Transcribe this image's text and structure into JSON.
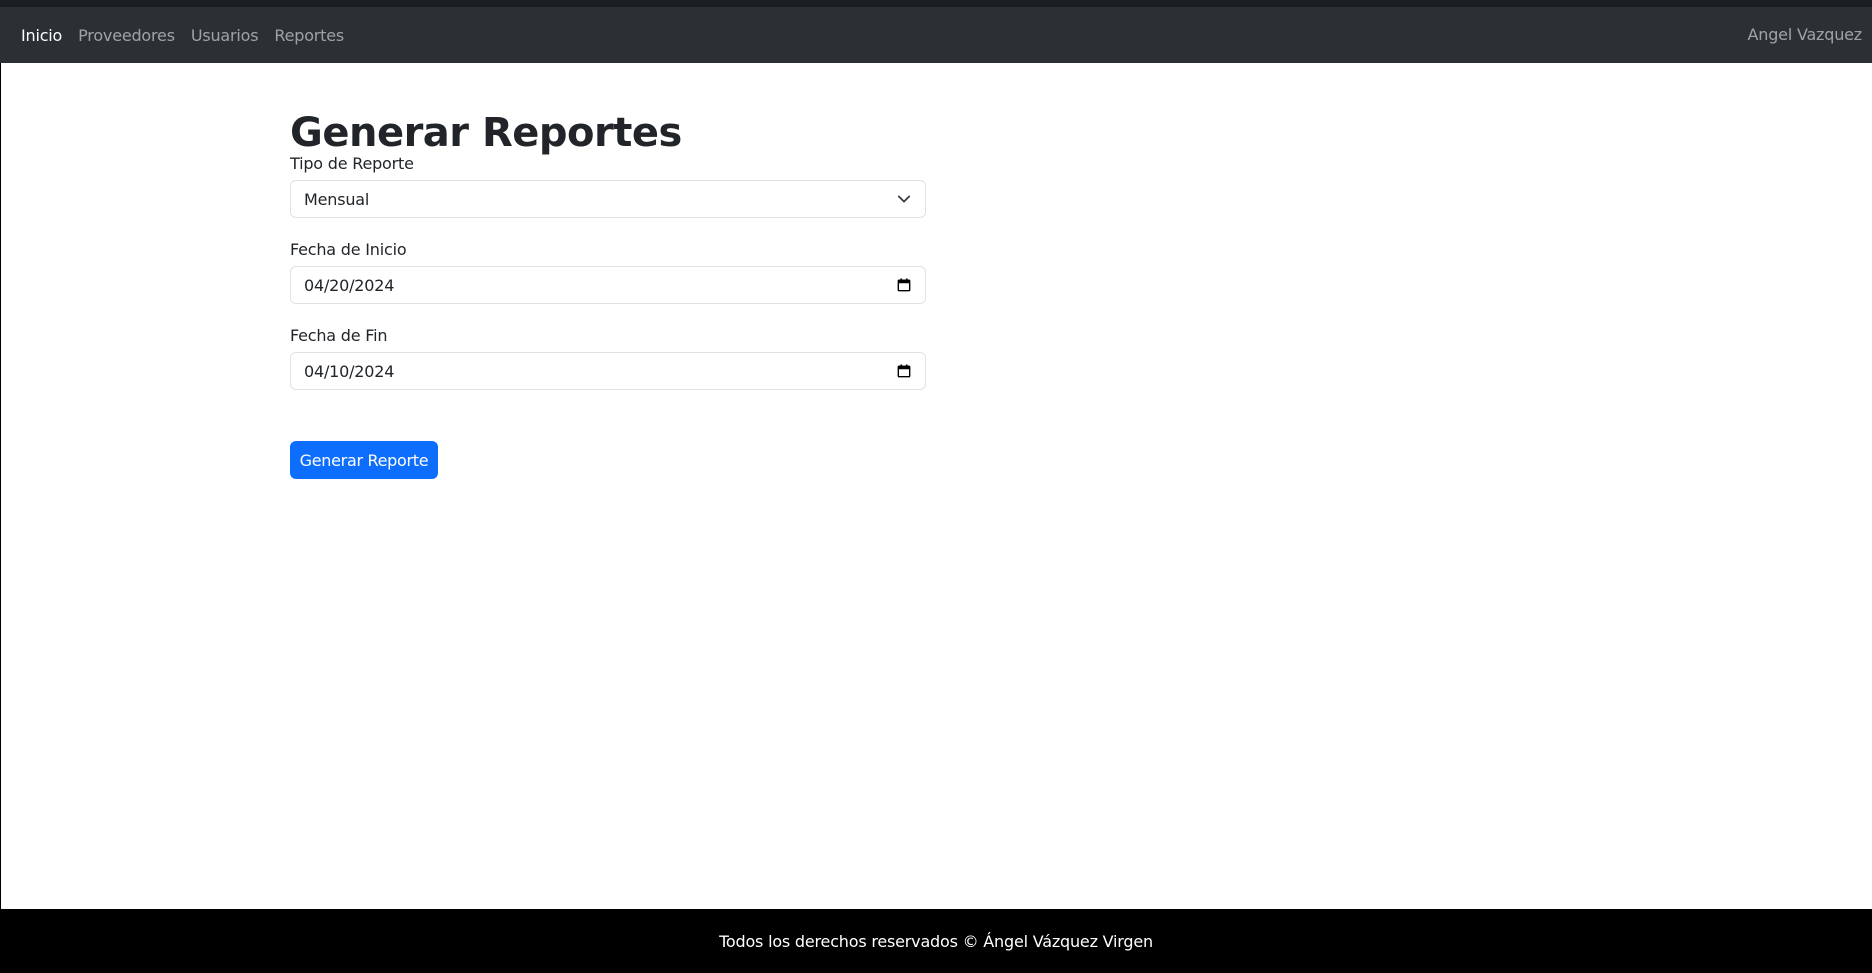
{
  "navbar": {
    "links": [
      {
        "label": "Inicio",
        "active": true
      },
      {
        "label": "Proveedores",
        "active": false
      },
      {
        "label": "Usuarios",
        "active": false
      },
      {
        "label": "Reportes",
        "active": false
      }
    ],
    "user_name": "Angel Vazquez"
  },
  "main": {
    "title": "Generar Reportes",
    "form": {
      "report_type": {
        "label": "Tipo de Reporte",
        "value": "Mensual",
        "icon": "chevron-down-icon"
      },
      "start_date": {
        "label": "Fecha de Inicio",
        "value": "04/20/2024",
        "icon": "calendar-icon"
      },
      "end_date": {
        "label": "Fecha de Fin",
        "value": "04/10/2024",
        "icon": "calendar-icon"
      },
      "submit_label": "Generar Reporte"
    }
  },
  "footer": {
    "text": "Todos los derechos reservados © Ángel Vázquez Virgen"
  },
  "colors": {
    "navbar_bg": "#2b3035",
    "primary": "#0d6efd",
    "footer_bg": "#000000",
    "text": "#212529"
  }
}
